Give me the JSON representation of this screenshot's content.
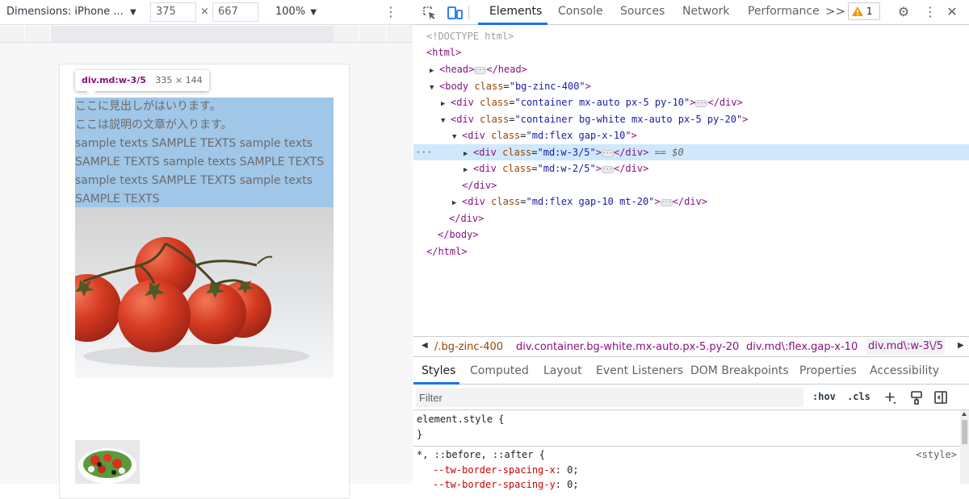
{
  "device_toolbar": {
    "dimensions_label": "Dimensions: iPhone ...",
    "width_value": "375",
    "times_sign": "×",
    "height_value": "667",
    "zoom_value": "100%",
    "caret": "▼"
  },
  "emulated_page": {
    "inspect_tooltip": {
      "selector": "div.md:w-3/5",
      "size": "335 × 144"
    },
    "heading_text": "ここに見出しがはいります。",
    "lines": [
      "ここは説明の文章が入ります。",
      "sample texts SAMPLE TEXTS sample texts",
      "SAMPLE TEXTS sample texts SAMPLE TEXTS",
      "sample texts SAMPLE TEXTS sample texts",
      "SAMPLE TEXTS"
    ]
  },
  "devtools": {
    "tabs": [
      "Elements",
      "Console",
      "Sources",
      "Network",
      "Performance"
    ],
    "active_tab": "Elements",
    "more_tabs": ">>",
    "warning_count": "1",
    "dom": {
      "doctype": "<!DOCTYPE html>",
      "html_open": "<html>",
      "head": "<head>",
      "head_close": "</head>",
      "body_open": "<body",
      "body_attr": "class",
      "body_class": "\"bg-zinc-400\"",
      "container1_class": "\"container mx-auto px-5 py-10\"",
      "container2_class": "\"container bg-white mx-auto px-5 py-20\"",
      "flex_class": "\"md:flex gap-x-10\"",
      "selected_class": "\"md:w-3/5\"",
      "sibling_class": "\"md:w-2/5\"",
      "flex2_class": "\"md:flex gap-10 mt-20\"",
      "div_open": "<div",
      "div_close": "</div>",
      "body_close": "</body>",
      "html_close": "</html>",
      "tag_end": ">",
      "selected_marker": "== $0",
      "ellipsis": "···"
    },
    "breadcrumbs": [
      "/.bg-zinc-400",
      "div.container.bg-white.mx-auto.px-5.py-20",
      "div.md\\:flex.gap-x-10",
      "div.md\\:w-3\\/5"
    ],
    "sub_tabs": [
      "Styles",
      "Computed",
      "Layout",
      "Event Listeners",
      "DOM Breakpoints",
      "Properties",
      "Accessibility"
    ],
    "active_sub_tab": "Styles",
    "filter_placeholder": "Filter",
    "hov_label": ":hov",
    "cls_label": ".cls",
    "styles": {
      "element_style": "element.style {",
      "close_brace": "}",
      "universal_selector": "*, ::before, ::after {",
      "source": "<style>",
      "prop1_name": "--tw-border-spacing-x",
      "prop1_value": ": 0;",
      "prop2_name": "--tw-border-spacing-y",
      "prop2_value": ": 0;"
    }
  }
}
